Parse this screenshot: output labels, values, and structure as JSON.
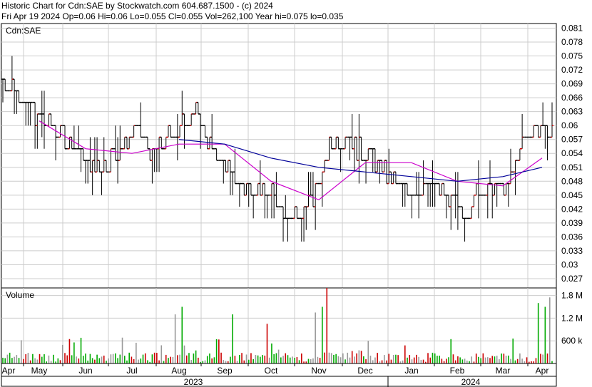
{
  "header": {
    "title": "Historic Chart for Cdn:SAE by Stockwatch.com 604.687.1500 - (c) 2024",
    "stats": "Fri Apr 19 2024   Op=0.06   Hi=0.06   Lo=0.055   Cl=0.055   Vol=262,100   Year hi=0.075   lo=0.035"
  },
  "price_panel": {
    "label": "Cdn:SAE",
    "yticks": [
      "0.081",
      "0.078",
      "0.075",
      "0.072",
      "0.069",
      "0.066",
      "0.063",
      "0.06",
      "0.057",
      "0.054",
      "0.051",
      "0.048",
      "0.045",
      "0.042",
      "0.039",
      "0.036",
      "0.033",
      "0.03",
      "0.027"
    ]
  },
  "volume_panel": {
    "label": "Volume",
    "yticks": [
      "1.8 M",
      "1.2 M",
      "600 k"
    ]
  },
  "x_axis": {
    "months": [
      "Apr",
      "May",
      "Jun",
      "Jul",
      "Aug",
      "Sep",
      "Oct",
      "Nov",
      "Dec",
      "Jan",
      "Feb",
      "Mar",
      "Apr"
    ],
    "years": [
      "2023",
      "2024"
    ]
  },
  "colors": {
    "up": "#cc0000",
    "down": "#000000",
    "ma_short": "#cc00cc",
    "ma_long": "#000099",
    "vol_up": "#00aa00",
    "vol_down": "#cc0000",
    "vol_flat": "#999999",
    "grid": "#cccccc"
  },
  "chart_data": {
    "type": "line",
    "subtype": "ohlc-bars-with-volume",
    "title": "Historic Chart for Cdn:SAE by Stockwatch.com 604.687.1500 - (c) 2024",
    "ylim": [
      0.025,
      0.082
    ],
    "volume_ylim": [
      0,
      2000000
    ],
    "grid": true,
    "x_months": [
      "Apr",
      "May",
      "Jun",
      "Jul",
      "Aug",
      "Sep",
      "Oct",
      "Nov",
      "Dec",
      "Jan",
      "Feb",
      "Mar",
      "Apr"
    ],
    "series": [
      {
        "name": "price",
        "points": [
          [
            "Apr",
            0.07
          ],
          [
            "Apr",
            0.067
          ],
          [
            "May",
            0.063
          ],
          [
            "May",
            0.06
          ],
          [
            "May",
            0.058
          ],
          [
            "Jun",
            0.055
          ],
          [
            "Jun",
            0.051
          ],
          [
            "Jun",
            0.052
          ],
          [
            "Jul",
            0.055
          ],
          [
            "Jul",
            0.06
          ],
          [
            "Jul",
            0.054
          ],
          [
            "Aug",
            0.057
          ],
          [
            "Aug",
            0.06
          ],
          [
            "Aug",
            0.063
          ],
          [
            "Sep",
            0.055
          ],
          [
            "Sep",
            0.051
          ],
          [
            "Oct",
            0.047
          ],
          [
            "Oct",
            0.046
          ],
          [
            "Oct",
            0.045
          ],
          [
            "Nov",
            0.042
          ],
          [
            "Nov",
            0.04
          ],
          [
            "Nov",
            0.045
          ],
          [
            "Nov",
            0.055
          ],
          [
            "Dec",
            0.058
          ],
          [
            "Dec",
            0.055
          ],
          [
            "Dec",
            0.053
          ],
          [
            "Jan",
            0.049
          ],
          [
            "Jan",
            0.046
          ],
          [
            "Jan",
            0.047
          ],
          [
            "Feb",
            0.047
          ],
          [
            "Feb",
            0.045
          ],
          [
            "Feb",
            0.04
          ],
          [
            "Mar",
            0.046
          ],
          [
            "Mar",
            0.047
          ],
          [
            "Mar",
            0.047
          ],
          [
            "Apr",
            0.057
          ],
          [
            "Apr",
            0.06
          ],
          [
            "Apr",
            0.058
          ]
        ]
      },
      {
        "name": "ma_short",
        "points": [
          [
            "May",
            0.061
          ],
          [
            "Jun",
            0.055
          ],
          [
            "Jul",
            0.054
          ],
          [
            "Aug",
            0.056
          ],
          [
            "Sep",
            0.056
          ],
          [
            "Oct",
            0.048
          ],
          [
            "Nov",
            0.044
          ],
          [
            "Dec",
            0.052
          ],
          [
            "Jan",
            0.052
          ],
          [
            "Feb",
            0.048
          ],
          [
            "Mar",
            0.047
          ],
          [
            "Apr",
            0.053
          ]
        ]
      },
      {
        "name": "ma_long",
        "points": [
          [
            "Aug",
            0.057
          ],
          [
            "Sep",
            0.056
          ],
          [
            "Oct",
            0.053
          ],
          [
            "Nov",
            0.051
          ],
          [
            "Dec",
            0.05
          ],
          [
            "Jan",
            0.049
          ],
          [
            "Feb",
            0.048
          ],
          [
            "Mar",
            0.049
          ],
          [
            "Apr",
            0.051
          ]
        ]
      }
    ],
    "volume_markers_k": [
      [
        "Aug",
        1300
      ],
      [
        "Aug",
        1500
      ],
      [
        "Sep",
        1300
      ],
      [
        "Oct",
        1050
      ],
      [
        "Nov",
        1500
      ],
      [
        "Nov",
        2000
      ],
      [
        "Nov",
        1350
      ],
      [
        "Dec",
        600
      ],
      [
        "Apr",
        1750
      ],
      [
        "Apr",
        1600
      ],
      [
        "Apr",
        1500
      ]
    ]
  }
}
